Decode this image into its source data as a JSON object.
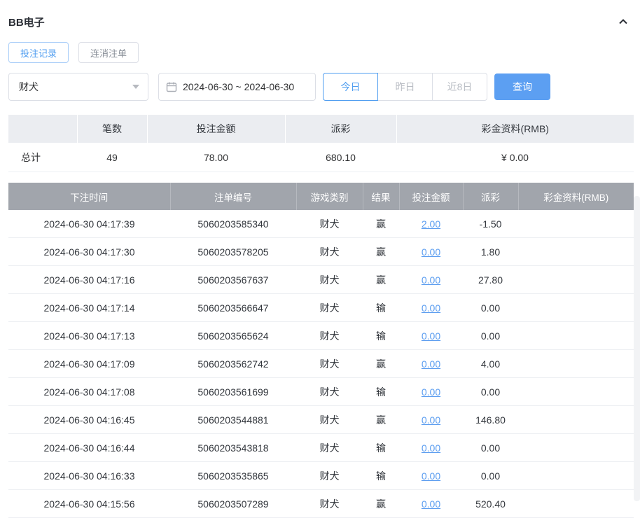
{
  "header": {
    "title": "BB电子"
  },
  "tabs": [
    {
      "label": "投注记录",
      "active": true
    },
    {
      "label": "连消注单",
      "active": false
    }
  ],
  "filters": {
    "game_select": {
      "value": "财犬"
    },
    "date_range": {
      "value": "2024-06-30 ~ 2024-06-30"
    },
    "quick_buttons": [
      {
        "label": "今日",
        "active": true
      },
      {
        "label": "昨日",
        "active": false
      },
      {
        "label": "近8日",
        "active": false
      }
    ],
    "search_label": "查询"
  },
  "summary": {
    "headers": [
      "",
      "笔数",
      "投注金额",
      "派彩",
      "彩金资料(RMB)"
    ],
    "row_label": "总计",
    "count": "49",
    "bet_amount": "78.00",
    "payout": "680.10",
    "bonus": "¥ 0.00"
  },
  "table": {
    "headers": [
      "下注时间",
      "注单编号",
      "游戏类别",
      "结果",
      "投注金额",
      "派彩",
      "彩金资料(RMB)"
    ],
    "rows": [
      {
        "time": "2024-06-30 04:17:39",
        "bet_id": "5060203585340",
        "game": "财犬",
        "result": "赢",
        "amount": "2.00",
        "payout": "-1.50",
        "negative": true,
        "bonus": ""
      },
      {
        "time": "2024-06-30 04:17:30",
        "bet_id": "5060203578205",
        "game": "财犬",
        "result": "赢",
        "amount": "0.00",
        "payout": "1.80",
        "negative": false,
        "bonus": ""
      },
      {
        "time": "2024-06-30 04:17:16",
        "bet_id": "5060203567637",
        "game": "财犬",
        "result": "赢",
        "amount": "0.00",
        "payout": "27.80",
        "negative": false,
        "bonus": ""
      },
      {
        "time": "2024-06-30 04:17:14",
        "bet_id": "5060203566647",
        "game": "财犬",
        "result": "输",
        "amount": "0.00",
        "payout": "0.00",
        "negative": false,
        "bonus": ""
      },
      {
        "time": "2024-06-30 04:17:13",
        "bet_id": "5060203565624",
        "game": "财犬",
        "result": "输",
        "amount": "0.00",
        "payout": "0.00",
        "negative": false,
        "bonus": ""
      },
      {
        "time": "2024-06-30 04:17:09",
        "bet_id": "5060203562742",
        "game": "财犬",
        "result": "赢",
        "amount": "0.00",
        "payout": "4.00",
        "negative": false,
        "bonus": ""
      },
      {
        "time": "2024-06-30 04:17:08",
        "bet_id": "5060203561699",
        "game": "财犬",
        "result": "输",
        "amount": "0.00",
        "payout": "0.00",
        "negative": false,
        "bonus": ""
      },
      {
        "time": "2024-06-30 04:16:45",
        "bet_id": "5060203544881",
        "game": "财犬",
        "result": "赢",
        "amount": "0.00",
        "payout": "146.80",
        "negative": false,
        "bonus": ""
      },
      {
        "time": "2024-06-30 04:16:44",
        "bet_id": "5060203543818",
        "game": "财犬",
        "result": "输",
        "amount": "0.00",
        "payout": "0.00",
        "negative": false,
        "bonus": ""
      },
      {
        "time": "2024-06-30 04:16:33",
        "bet_id": "5060203535865",
        "game": "财犬",
        "result": "输",
        "amount": "0.00",
        "payout": "0.00",
        "negative": false,
        "bonus": ""
      },
      {
        "time": "2024-06-30 04:15:56",
        "bet_id": "5060203507289",
        "game": "财犬",
        "result": "赢",
        "amount": "0.00",
        "payout": "520.40",
        "negative": false,
        "bonus": ""
      }
    ]
  },
  "colors": {
    "accent": "#5c9ff2",
    "link": "#5d9ef0",
    "negative": "#e15b52",
    "table_header_bg": "#a1a5ac",
    "summary_header_bg": "#ebedf1"
  }
}
